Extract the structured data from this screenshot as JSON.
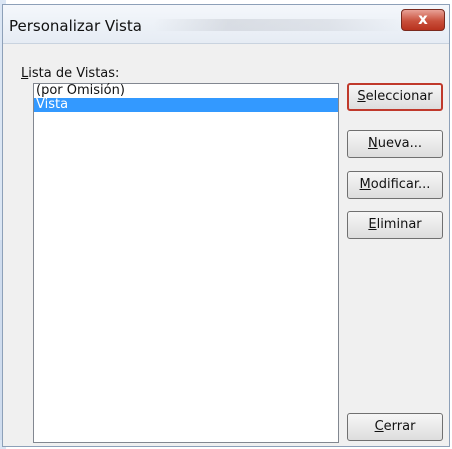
{
  "window": {
    "title": "Personalizar Vista",
    "close_label": "x"
  },
  "list": {
    "label_accel": "L",
    "label_rest": "ista de Vistas:",
    "items": [
      {
        "label": "(por Omisión)",
        "selected": false
      },
      {
        "label": "Vista",
        "selected": true
      }
    ]
  },
  "buttons": {
    "select": {
      "accel": "S",
      "rest": "eleccionar"
    },
    "new": {
      "accel": "N",
      "rest": "ueva..."
    },
    "modify": {
      "accel": "M",
      "rest": "odificar..."
    },
    "delete": {
      "accel": "E",
      "rest": "liminar"
    },
    "close": {
      "accel": "C",
      "rest": "errar"
    }
  },
  "colors": {
    "selection": "#3399ff",
    "default_button_border": "#c0392b",
    "close_button": "#c9503c"
  }
}
